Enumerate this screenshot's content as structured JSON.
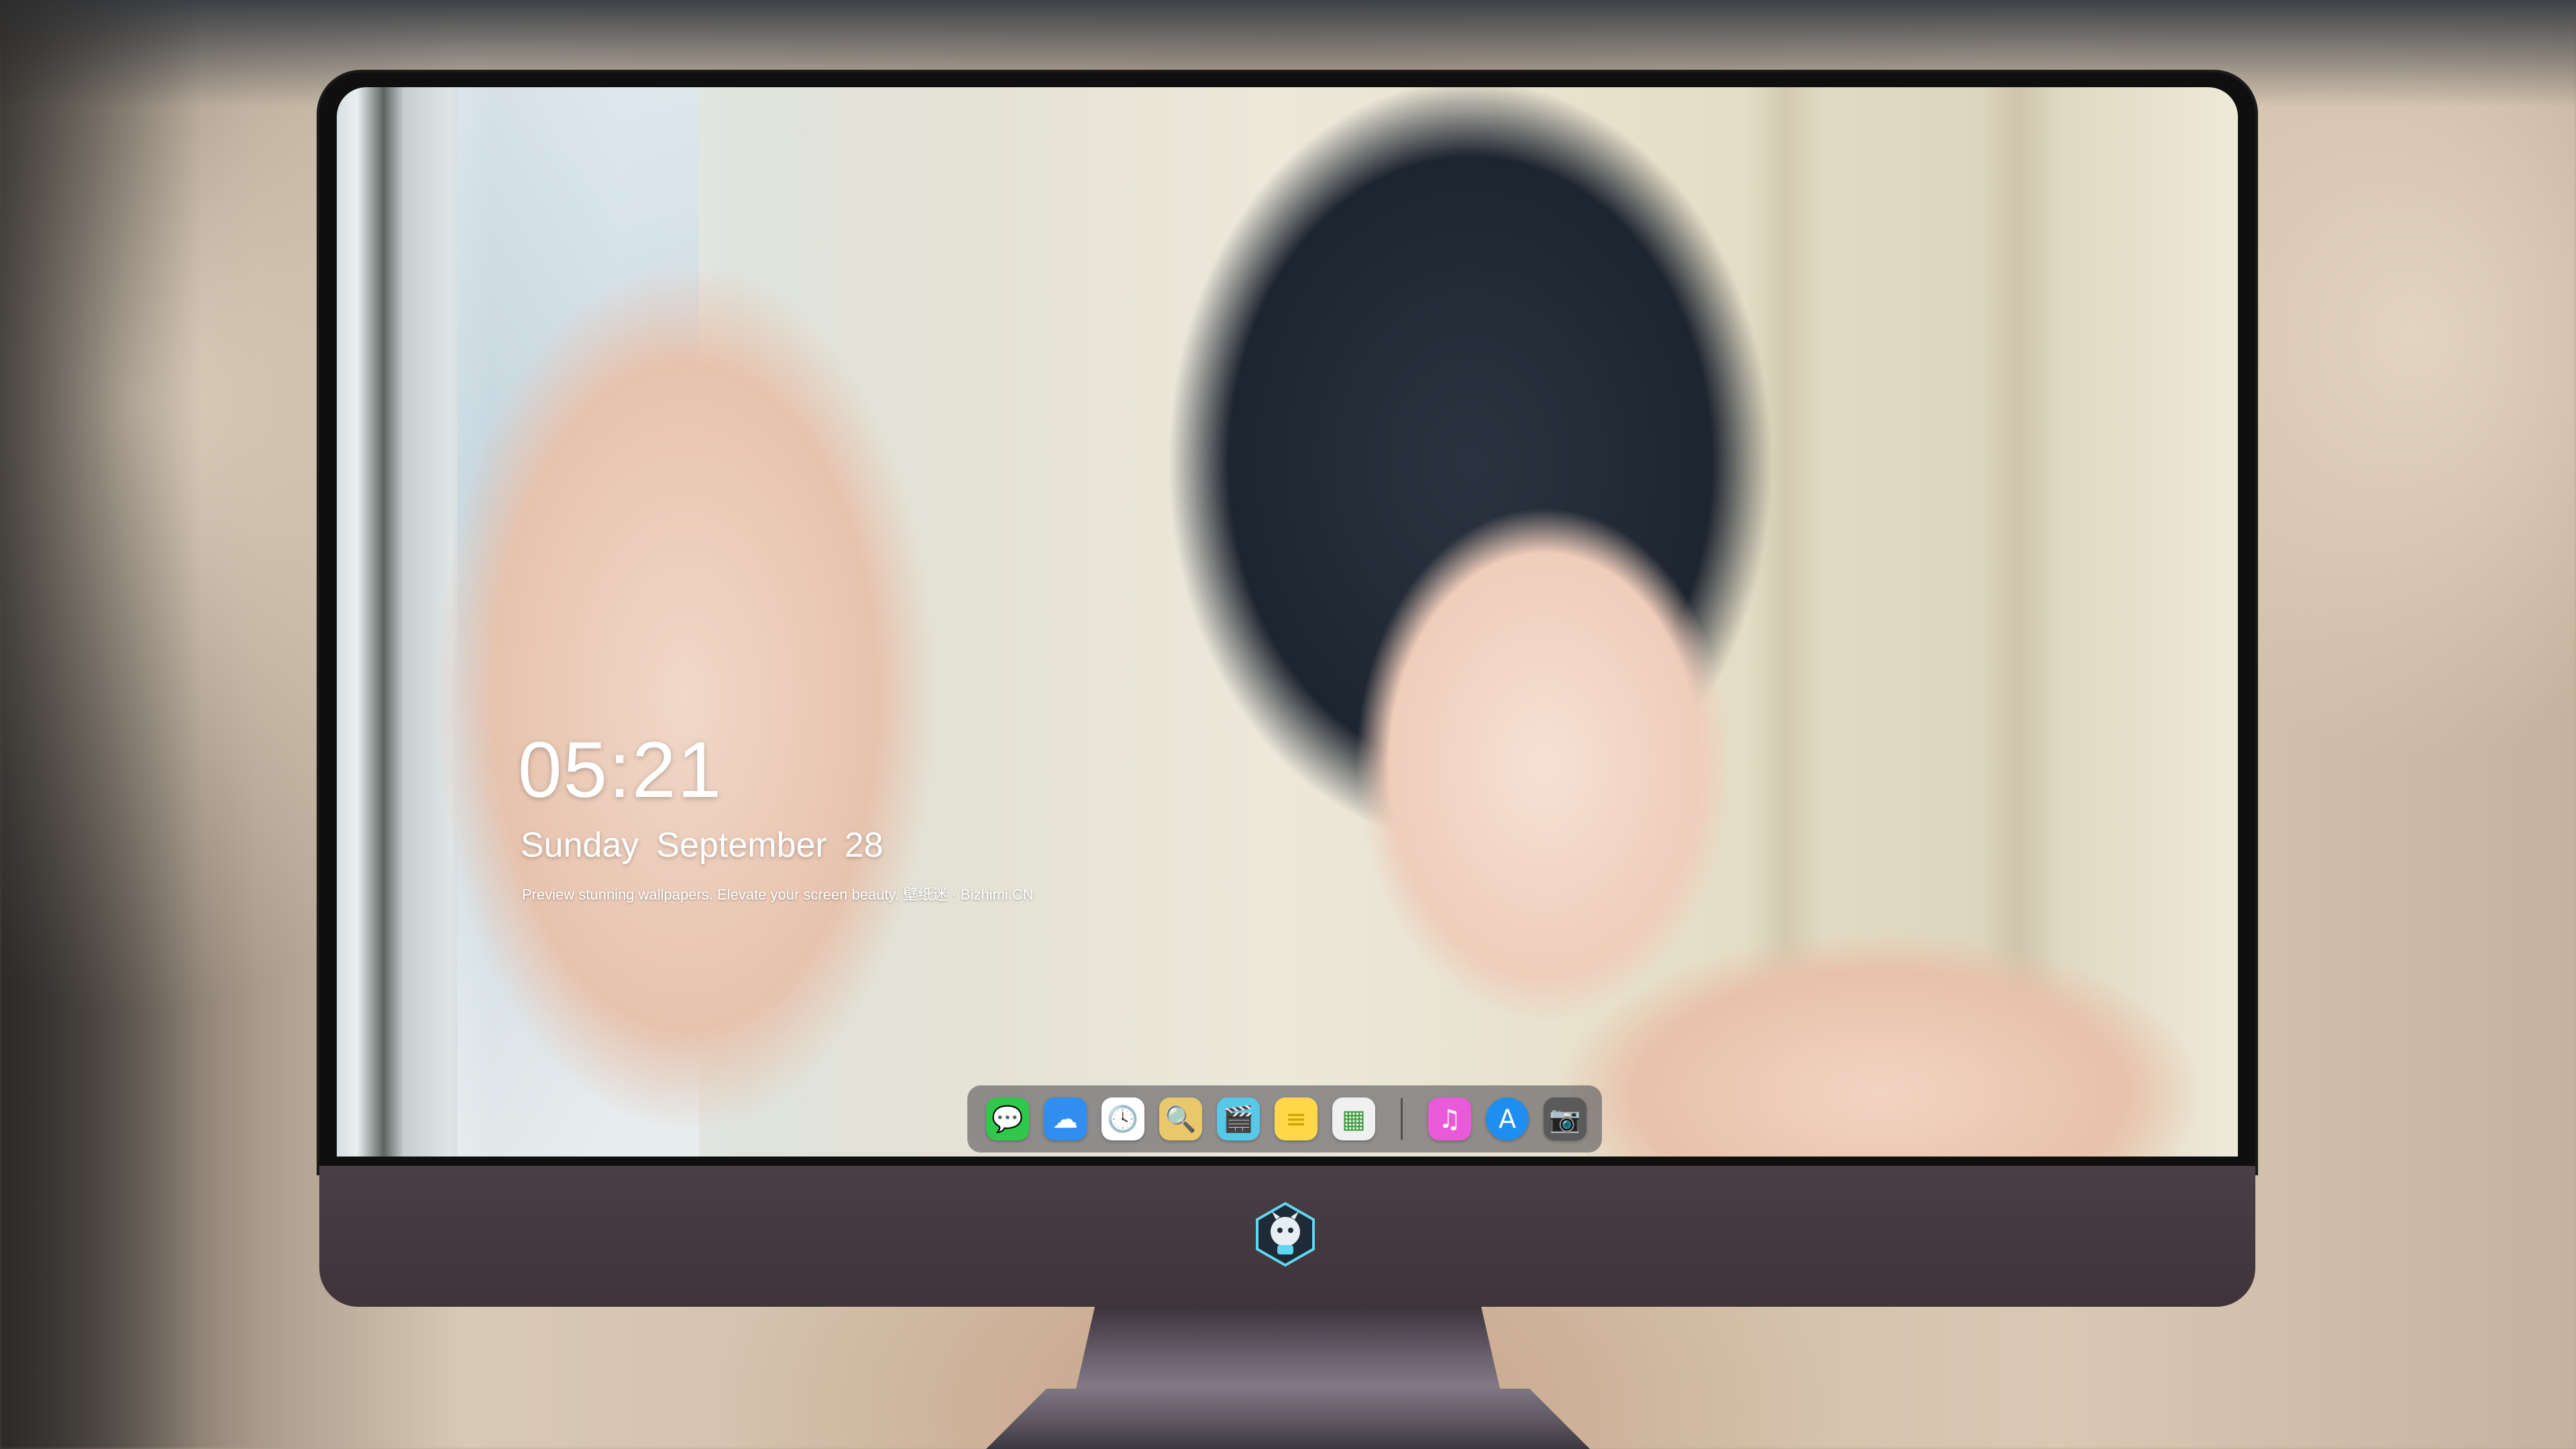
{
  "lockscreen": {
    "time": "05:21",
    "weekday": "Sunday",
    "month": "September",
    "day": "28",
    "caption": "Preview stunning wallpapers. Elevate your screen beauty. 壁纸迷 · Bizhimi.CN"
  },
  "dock": {
    "icons": [
      {
        "name": "messages-icon",
        "glyph": "💬",
        "color": "#2fc84a"
      },
      {
        "name": "weather-icon",
        "glyph": "☁",
        "color": "#2f8ef0"
      },
      {
        "name": "clock-icon",
        "glyph": "🕓",
        "color": "#ffffff"
      },
      {
        "name": "preview-icon",
        "glyph": "🔍",
        "color": "#e8c86a"
      },
      {
        "name": "video-editor-icon",
        "glyph": "🎬",
        "color": "#56c8e8"
      },
      {
        "name": "notes-icon",
        "glyph": "≡",
        "color": "#ffd84a"
      },
      {
        "name": "photo-booth-icon",
        "glyph": "▦",
        "color": "#f0f0f0"
      },
      {
        "name": "music-icon",
        "glyph": "♫",
        "color": "#e85ad8"
      },
      {
        "name": "app-store-icon",
        "glyph": "A",
        "color": "#1e8ef0"
      },
      {
        "name": "camera-icon",
        "glyph": "📷",
        "color": "#5a5a5a"
      }
    ]
  }
}
